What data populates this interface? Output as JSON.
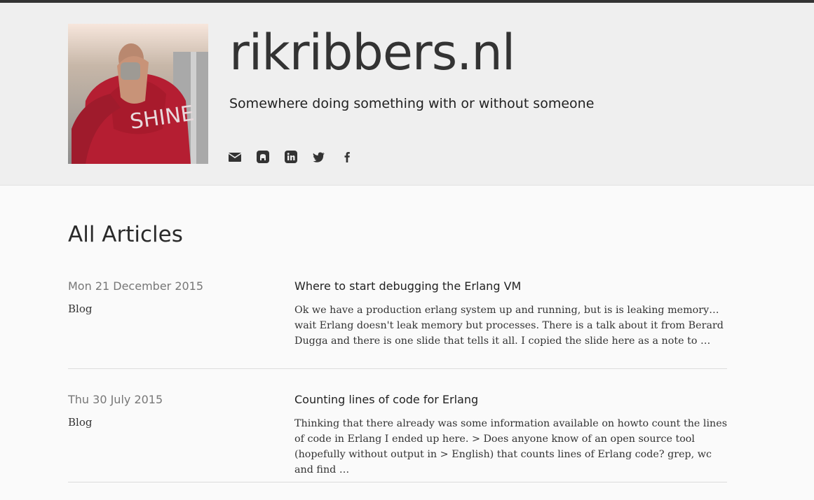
{
  "site": {
    "title": "rikribbers.nl",
    "tagline": "Somewhere doing something with or without someone"
  },
  "social_icons": [
    "envelope-icon",
    "github-icon",
    "linkedin-icon",
    "twitter-icon",
    "facebook-icon"
  ],
  "main": {
    "section_title": "All Articles",
    "articles": [
      {
        "date": "Mon 21 December 2015",
        "category": "Blog",
        "title": "Where to start debugging the Erlang VM",
        "excerpt": "Ok we have a production erlang system up and running, but is is leaking memory… wait Erlang doesn't leak memory but processes. There is a talk about it from Berard Dugga and there is one slide that tells it all. I copied the slide here as a note to …"
      },
      {
        "date": "Thu 30 July 2015",
        "category": "Blog",
        "title": "Counting lines of code for Erlang",
        "excerpt": "Thinking that there already was some information available on howto count the lines of code in Erlang I ended up here. > Does anyone know of an open source tool (hopefully without output in > English) that counts lines of Erlang code? grep, wc and find …"
      }
    ]
  },
  "colors": {
    "topbar": "#333333",
    "header_bg": "#efefef",
    "page_bg": "#fafafa",
    "text": "#333333",
    "muted": "#777777"
  }
}
